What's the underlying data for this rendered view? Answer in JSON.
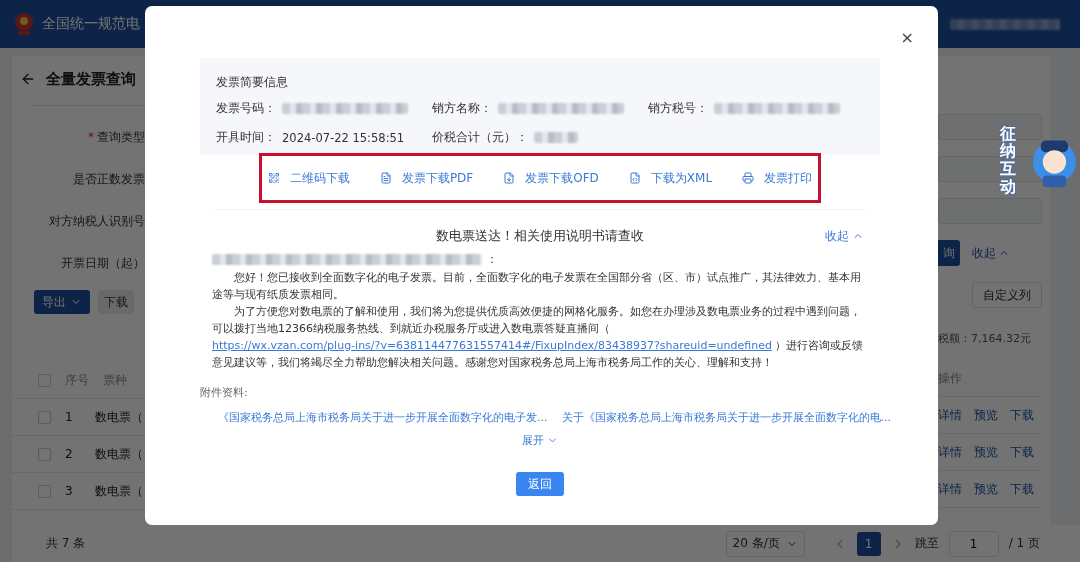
{
  "header": {
    "title": "全国统一规范电"
  },
  "page": {
    "title": "全量发票查询"
  },
  "filters": [
    {
      "label": "查询类型",
      "required_mark": "*"
    },
    {
      "label": "是否正数发票"
    },
    {
      "label": "对方纳税人识别号"
    },
    {
      "label": "开票日期（起）"
    }
  ],
  "search_button": "询",
  "collapse_link": "收起",
  "toolbar": {
    "export": "导出",
    "download": "下载",
    "custom_columns": "自定义列"
  },
  "summary": "税额：7,164.32元",
  "table": {
    "select_all_checked": false,
    "columns": [
      "序号",
      "票种"
    ],
    "action_column": "操作",
    "rows": [
      {
        "index": "1",
        "type": "数电票（",
        "checked": false,
        "actions": [
          "详情",
          "预览",
          "下载"
        ]
      },
      {
        "index": "2",
        "type": "数电票（",
        "checked": false,
        "actions": [
          "详情",
          "预览",
          "下载"
        ]
      },
      {
        "index": "3",
        "type": "数电票（",
        "checked": false,
        "actions": [
          "详情",
          "预览",
          "下载"
        ]
      }
    ]
  },
  "footer": {
    "total": "共 7 条",
    "page_size": "20 条/页",
    "pages": [
      {
        "label": "1",
        "selected": true
      }
    ],
    "jump_label": "跳至",
    "jump_value": "1",
    "page_count": "/ 1 页"
  },
  "mascot": {
    "text": "征纳互动"
  },
  "modal": {
    "close": "×",
    "info": {
      "title": "发票简要信息",
      "fields": [
        {
          "label": "发票号码：",
          "value_hidden": true
        },
        {
          "label": "销方名称：",
          "value_hidden": true
        },
        {
          "label": "销方税号：",
          "value_hidden": true
        },
        {
          "label": "开具时间：",
          "value": "2024-07-22 15:58:51"
        },
        {
          "label": "价税合计（元）：",
          "value_hidden": true
        }
      ]
    },
    "actions": [
      {
        "kind": "qr",
        "label": "二维码下载"
      },
      {
        "kind": "pdf",
        "label": "发票下载PDF"
      },
      {
        "kind": "ofd",
        "label": "发票下载OFD"
      },
      {
        "kind": "xml",
        "label": "下载为XML"
      },
      {
        "kind": "print",
        "label": "发票打印"
      }
    ],
    "notice": {
      "heading": "数电票送达！相关使用说明书请查收",
      "collapse": "收起",
      "salutation_suffix": "：",
      "paragraph_1": "您好！您已接收到全面数字化的电子发票。目前，全面数字化的电子发票在全国部分省（区、市）试点推广，其法律效力、基本用途等与现有纸质发票相同。",
      "paragraph_2": {
        "before": "为了方便您对数电票的了解和使用，我们将为您提供优质高效便捷的网格化服务。如您在办理涉及数电票业务的过程中遇到问题，可以拨打当地12366纳税服务热线、到就近办税服务厅或进入数电票答疑直播间（ ",
        "link": "https://wx.vzan.com/plug-ins/?v=638114477631557414#/FixupIndex/83438937?shareuid=undefined",
        "after": " ）进行咨询或反馈意见建议等，我们将竭尽全力帮助您解决相关问题。感谢您对国家税务总局上海市税务局工作的关心、理解和支持！"
      }
    },
    "attachments": {
      "label": "附件资料:",
      "items": [
        "《国家税务总局上海市税务局关于进一步开展全面数字化的电子发...",
        "关于《国家税务总局上海市税务局关于进一步开展全面数字化的电..."
      ],
      "expand": "展开"
    },
    "back_button": "返回"
  }
}
